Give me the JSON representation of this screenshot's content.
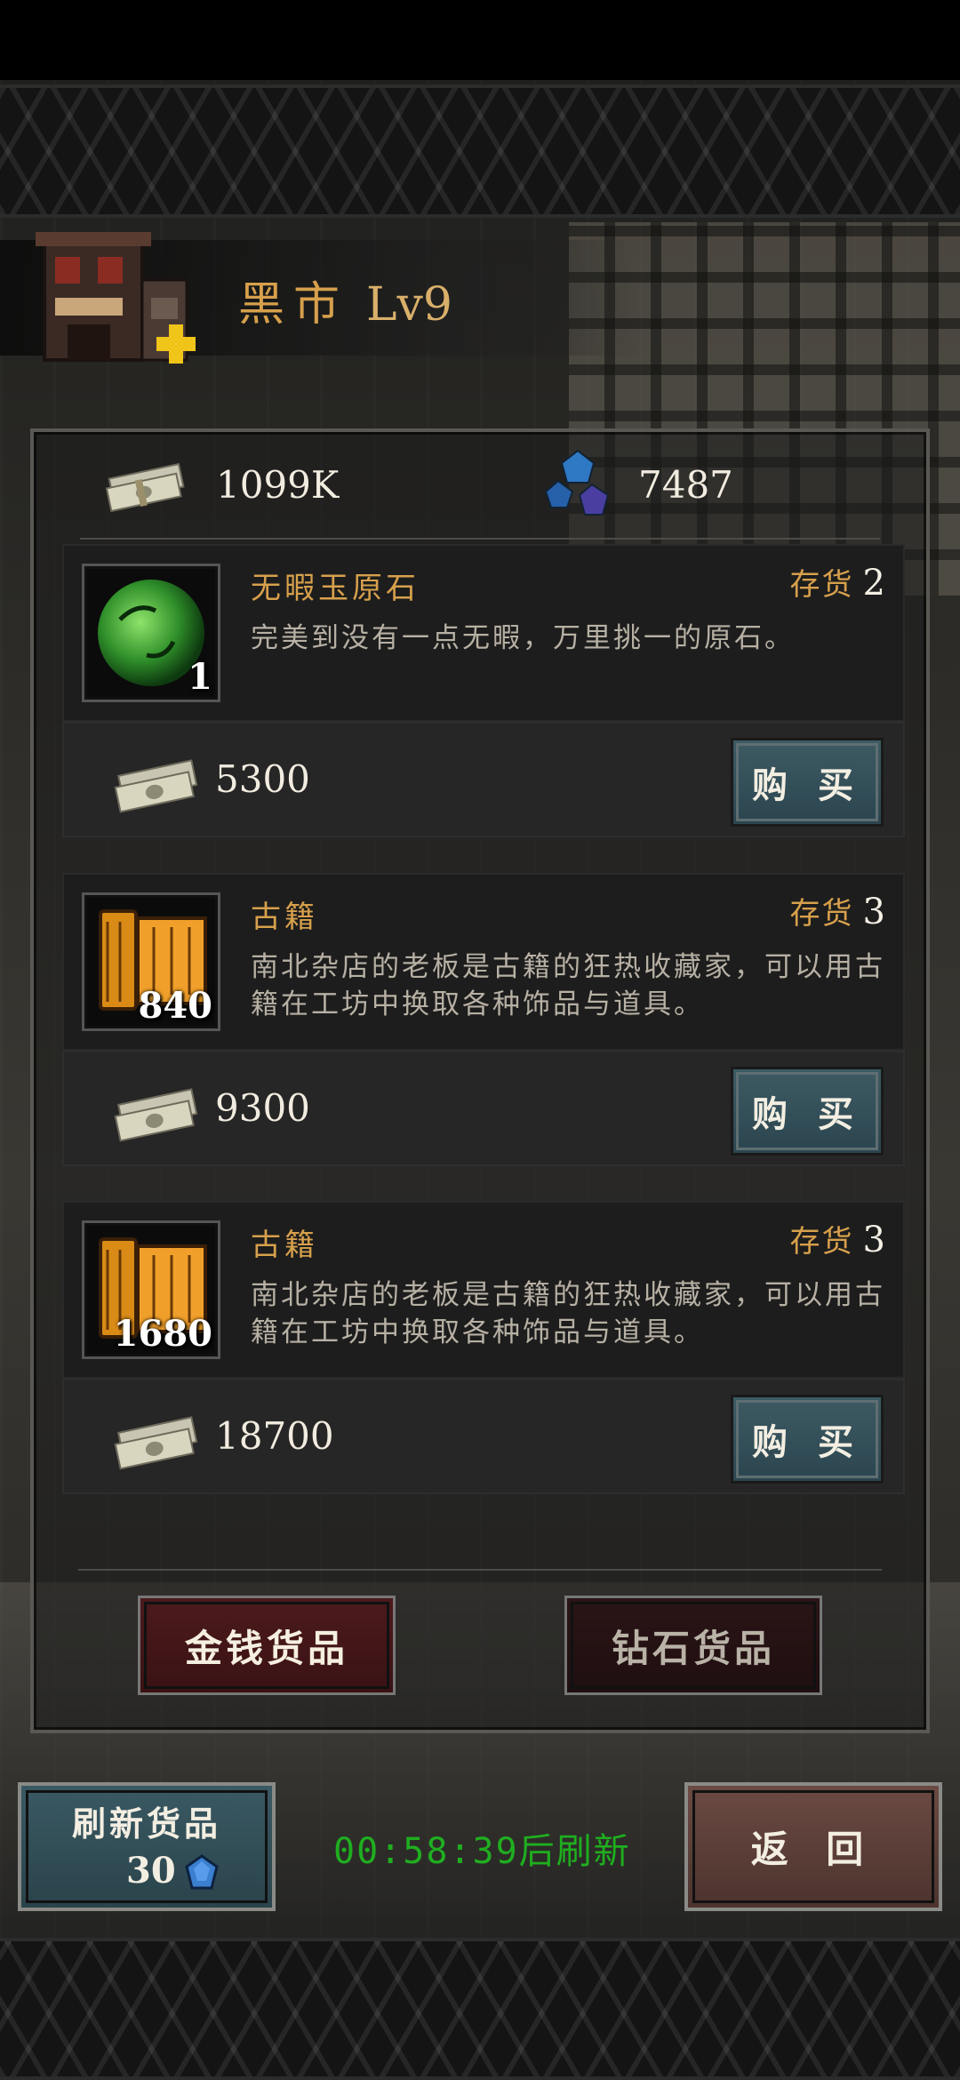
{
  "header": {
    "title": "黑市",
    "level": "Lv9"
  },
  "currency": {
    "money": "1099K",
    "diamonds": "7487"
  },
  "items": [
    {
      "name": "无暇玉原石",
      "stock_label": "存货",
      "stock": "2",
      "quantity": "1",
      "description": "完美到没有一点无暇，万里挑一的原石。",
      "price": "5300",
      "buy_label": "购 买",
      "icon": "jade-stone-icon"
    },
    {
      "name": "古籍",
      "stock_label": "存货",
      "stock": "3",
      "quantity": "840",
      "description": "南北杂店的老板是古籍的狂热收藏家，可以用古籍在工坊中换取各种饰品与道具。",
      "price": "9300",
      "buy_label": "购 买",
      "icon": "ancient-scroll-icon"
    },
    {
      "name": "古籍",
      "stock_label": "存货",
      "stock": "3",
      "quantity": "1680",
      "description": "南北杂店的老板是古籍的狂热收藏家，可以用古籍在工坊中换取各种饰品与道具。",
      "price": "18700",
      "buy_label": "购 买",
      "icon": "ancient-scroll-icon"
    }
  ],
  "tabs": {
    "money_goods": "金钱货品",
    "diamond_goods": "钻石货品"
  },
  "refresh": {
    "label": "刷新货品",
    "cost": "30",
    "timer": "00:58:39后刷新"
  },
  "back_label": "返 回",
  "colors": {
    "title_gold": "#d7a04c",
    "timer_green": "#1fae1f",
    "buy_button": "#3d5a63",
    "tab_money": "#4c1a1c"
  }
}
